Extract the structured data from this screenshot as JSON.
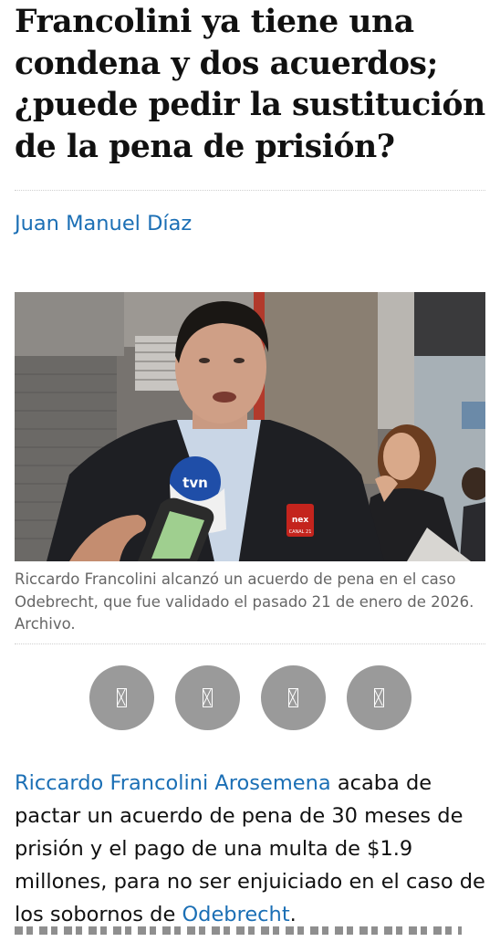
{
  "article": {
    "headline": "Francolini ya tiene una condena y dos acuerdos; ¿puede pedir la sustitución de la pena de prisión?",
    "author": "Juan Manuel Díaz",
    "image": {
      "caption": "Riccardo Francolini alcanzó un acuerdo de pena en el caso Odebrecht, que fue validado el pasado 21 de enero de 2026. Archivo.",
      "mic_brand": "tvn",
      "badge_brand": "nex",
      "badge_channel": "CANAL 21"
    },
    "share_buttons": [
      {
        "icon": "share-icon-1"
      },
      {
        "icon": "share-icon-2"
      },
      {
        "icon": "share-icon-3"
      },
      {
        "icon": "share-icon-4"
      }
    ],
    "body": {
      "link1": "Riccardo Francolini Arosemena",
      "text1": " acaba de pactar un acuerdo de pena de 30 meses de prisión y el pago de una multa de $1.9 millones, para no ser enjuiciado en el caso de los sobornos de ",
      "link2": "Odebrecht",
      "text2": "."
    }
  },
  "colors": {
    "link": "#1b6fb5",
    "headline": "#111111",
    "caption": "#666666",
    "share_button": "#9a9a9a"
  }
}
